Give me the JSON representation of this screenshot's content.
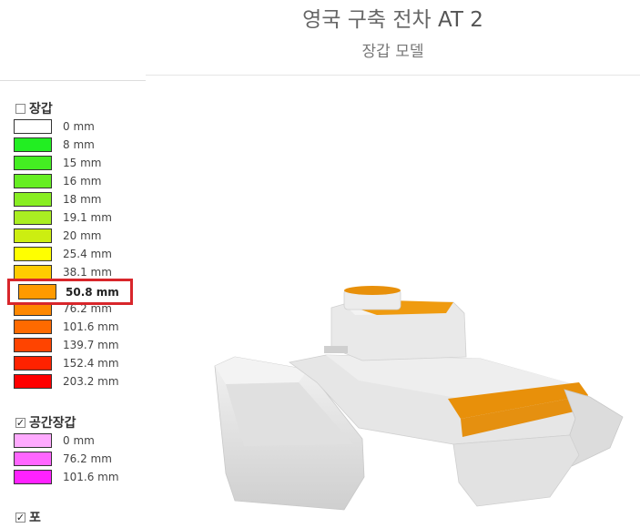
{
  "header": {
    "title_prefix": "영국 구축 전차",
    "title_model": "AT 2",
    "subtitle": "장갑 모델"
  },
  "armor_legend": {
    "label": "장갑",
    "checked": false,
    "items": [
      {
        "label": "0 mm",
        "color": "#ffffff"
      },
      {
        "label": "8 mm",
        "color": "#22ee22"
      },
      {
        "label": "15 mm",
        "color": "#44ee22"
      },
      {
        "label": "16 mm",
        "color": "#66ee22"
      },
      {
        "label": "18 mm",
        "color": "#88ee22"
      },
      {
        "label": "19.1 mm",
        "color": "#aaee22"
      },
      {
        "label": "20 mm",
        "color": "#ccee11"
      },
      {
        "label": "25.4 mm",
        "color": "#ffff00"
      },
      {
        "label": "38.1 mm",
        "color": "#ffcc00"
      },
      {
        "label": "50.8 mm",
        "color": "#ff9a00"
      },
      {
        "label": "76.2 mm",
        "color": "#ff8800"
      },
      {
        "label": "101.6 mm",
        "color": "#ff6a00"
      },
      {
        "label": "139.7 mm",
        "color": "#ff4400"
      },
      {
        "label": "152.4 mm",
        "color": "#ff2200"
      },
      {
        "label": "203.2 mm",
        "color": "#ff0000"
      }
    ],
    "highlighted_index": 9
  },
  "spaced_legend": {
    "label": "공간장갑",
    "checked": true,
    "items": [
      {
        "label": "0 mm",
        "color": "#ffaaff"
      },
      {
        "label": "76.2 mm",
        "color": "#ff66ff"
      },
      {
        "label": "101.6 mm",
        "color": "#ff22ff"
      }
    ]
  },
  "gun_legend": {
    "label": "포",
    "checked": true
  },
  "colors": {
    "highlight_border": "#d8262b",
    "armor_accent": "#e8900a",
    "hull_gray": "#e2e2e2"
  }
}
